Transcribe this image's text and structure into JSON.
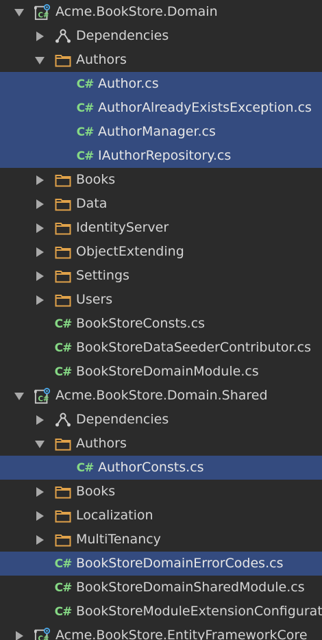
{
  "tree": {
    "rows": [
      {
        "label": "Acme.BookStore.Domain",
        "level": 0,
        "expanded": true,
        "icon": "csharp-project-icon",
        "selected": false
      },
      {
        "label": "Dependencies",
        "level": 1,
        "expanded": false,
        "icon": "dependencies-icon",
        "selected": false
      },
      {
        "label": "Authors",
        "level": 1,
        "expanded": true,
        "icon": "folder-icon",
        "selected": false
      },
      {
        "label": "Author.cs",
        "level": 2,
        "expanded": null,
        "icon": "csharp-file-icon",
        "selected": true
      },
      {
        "label": "AuthorAlreadyExistsException.cs",
        "level": 2,
        "expanded": null,
        "icon": "csharp-file-icon",
        "selected": true
      },
      {
        "label": "AuthorManager.cs",
        "level": 2,
        "expanded": null,
        "icon": "csharp-file-icon",
        "selected": true
      },
      {
        "label": "IAuthorRepository.cs",
        "level": 2,
        "expanded": null,
        "icon": "csharp-file-icon",
        "selected": true
      },
      {
        "label": "Books",
        "level": 1,
        "expanded": false,
        "icon": "folder-icon",
        "selected": false
      },
      {
        "label": "Data",
        "level": 1,
        "expanded": false,
        "icon": "folder-icon",
        "selected": false
      },
      {
        "label": "IdentityServer",
        "level": 1,
        "expanded": false,
        "icon": "folder-icon",
        "selected": false
      },
      {
        "label": "ObjectExtending",
        "level": 1,
        "expanded": false,
        "icon": "folder-icon",
        "selected": false
      },
      {
        "label": "Settings",
        "level": 1,
        "expanded": false,
        "icon": "folder-icon",
        "selected": false
      },
      {
        "label": "Users",
        "level": 1,
        "expanded": false,
        "icon": "folder-icon",
        "selected": false
      },
      {
        "label": "BookStoreConsts.cs",
        "level": 1,
        "expanded": null,
        "icon": "csharp-file-icon",
        "selected": false
      },
      {
        "label": "BookStoreDataSeederContributor.cs",
        "level": 1,
        "expanded": null,
        "icon": "csharp-file-icon",
        "selected": false
      },
      {
        "label": "BookStoreDomainModule.cs",
        "level": 1,
        "expanded": null,
        "icon": "csharp-file-icon",
        "selected": false
      },
      {
        "label": "Acme.BookStore.Domain.Shared",
        "level": 0,
        "expanded": true,
        "icon": "csharp-project-icon",
        "selected": false
      },
      {
        "label": "Dependencies",
        "level": 1,
        "expanded": false,
        "icon": "dependencies-icon",
        "selected": false
      },
      {
        "label": "Authors",
        "level": 1,
        "expanded": true,
        "icon": "folder-icon",
        "selected": false
      },
      {
        "label": "AuthorConsts.cs",
        "level": 2,
        "expanded": null,
        "icon": "csharp-file-icon",
        "selected": true
      },
      {
        "label": "Books",
        "level": 1,
        "expanded": false,
        "icon": "folder-icon",
        "selected": false
      },
      {
        "label": "Localization",
        "level": 1,
        "expanded": false,
        "icon": "folder-icon",
        "selected": false
      },
      {
        "label": "MultiTenancy",
        "level": 1,
        "expanded": false,
        "icon": "folder-icon",
        "selected": false
      },
      {
        "label": "BookStoreDomainErrorCodes.cs",
        "level": 1,
        "expanded": null,
        "icon": "csharp-file-icon",
        "selected": true
      },
      {
        "label": "BookStoreDomainSharedModule.cs",
        "level": 1,
        "expanded": null,
        "icon": "csharp-file-icon",
        "selected": false
      },
      {
        "label": "BookStoreModuleExtensionConfigurator.cs",
        "level": 1,
        "expanded": null,
        "icon": "csharp-file-icon",
        "selected": false
      },
      {
        "label": "Acme.BookStore.EntityFrameworkCore",
        "level": 0,
        "expanded": false,
        "icon": "csharp-project-icon",
        "selected": false
      }
    ]
  },
  "colors": {
    "background": "#2b2b2b",
    "selection": "#344b7f",
    "text": "#d4d4d4",
    "folder": "#e0a24a",
    "csharp": "#86d985",
    "arrow": "#a9a9a9"
  }
}
